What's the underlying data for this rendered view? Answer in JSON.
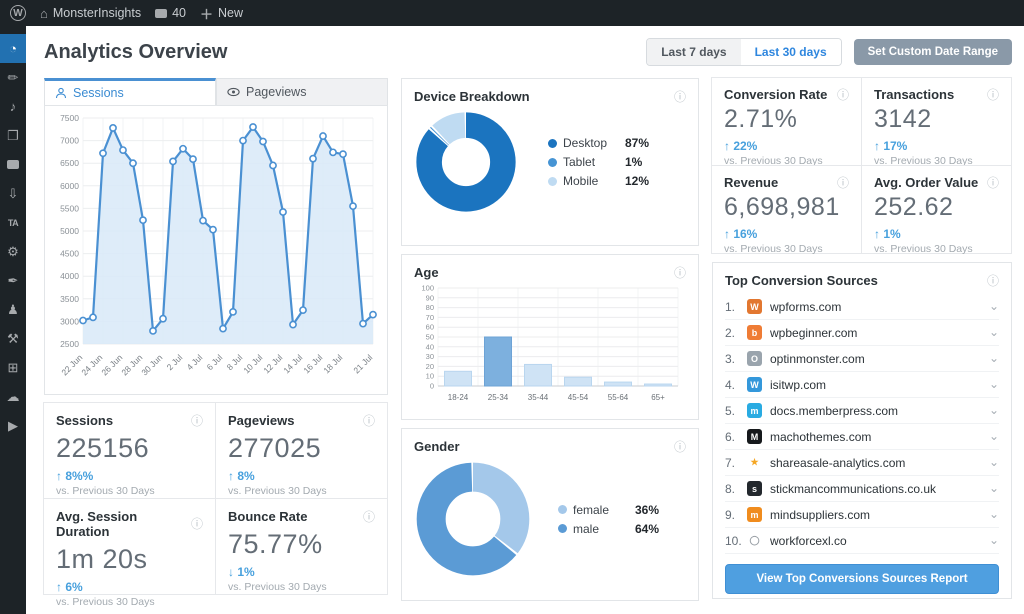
{
  "admin_bar": {
    "wp_logo": "W",
    "site_name": "MonsterInsights",
    "comments_count": "40",
    "new_label": "New"
  },
  "sidebar": {
    "items": [
      {
        "name": "monsterinsights-gauge",
        "glyph": "◔",
        "active": true
      },
      {
        "name": "posts-pin",
        "glyph": "✏",
        "active": false
      },
      {
        "name": "media",
        "glyph": "♪",
        "active": false
      },
      {
        "name": "pages",
        "glyph": "❐",
        "active": false
      },
      {
        "name": "comments",
        "glyph": "",
        "active": false
      },
      {
        "name": "screen-download",
        "glyph": "⇩",
        "active": false
      },
      {
        "name": "ta-badge",
        "glyph": "TA",
        "active": false
      },
      {
        "name": "plugin",
        "glyph": "⚙",
        "active": false
      },
      {
        "name": "brush",
        "glyph": "✒",
        "active": false
      },
      {
        "name": "users",
        "glyph": "♟",
        "active": false
      },
      {
        "name": "tools-wrench",
        "glyph": "⚒",
        "active": false
      },
      {
        "name": "settings",
        "glyph": "⊞",
        "active": false
      },
      {
        "name": "cloud",
        "glyph": "☁",
        "active": false
      },
      {
        "name": "video-play",
        "glyph": "▶",
        "active": false
      }
    ]
  },
  "header": {
    "title": "Analytics Overview",
    "range_buttons": [
      {
        "label": "Last 7 days",
        "active": false
      },
      {
        "label": "Last 30 days",
        "active": true
      }
    ],
    "custom_range_label": "Set Custom Date Range"
  },
  "tabs": [
    {
      "label": "Sessions",
      "icon": "person-icon",
      "active": true
    },
    {
      "label": "Pageviews",
      "icon": "eye-icon",
      "active": false
    }
  ],
  "chart_data": [
    {
      "id": "sessions-line",
      "type": "line",
      "title": "Sessions over time",
      "x": [
        "22 Jun",
        "23 Jun",
        "24 Jun",
        "25 Jun",
        "26 Jun",
        "27 Jun",
        "28 Jun",
        "29 Jun",
        "30 Jun",
        "1 Jul",
        "2 Jul",
        "3 Jul",
        "4 Jul",
        "5 Jul",
        "6 Jul",
        "7 Jul",
        "8 Jul",
        "9 Jul",
        "10 Jul",
        "11 Jul",
        "12 Jul",
        "13 Jul",
        "14 Jul",
        "15 Jul",
        "16 Jul",
        "17 Jul",
        "18 Jul",
        "19 Jul",
        "20 Jul",
        "21 Jul"
      ],
      "values": [
        3020,
        3090,
        6720,
        7280,
        6790,
        6500,
        5240,
        2790,
        3060,
        6540,
        6820,
        6590,
        5230,
        5030,
        2840,
        3210,
        7000,
        7300,
        6980,
        6450,
        5420,
        2930,
        3250,
        6600,
        7100,
        6740,
        6700,
        5550,
        2950,
        3150
      ],
      "tick_indices": [
        0,
        2,
        4,
        6,
        8,
        10,
        12,
        14,
        16,
        18,
        20,
        22,
        24,
        26,
        29
      ],
      "ylim": [
        2500,
        7500
      ],
      "ytick_step": 500,
      "grid": true,
      "line_color": "#4a90d2",
      "fill_color": "#d8e9f8"
    },
    {
      "id": "device-donut",
      "type": "pie",
      "title": "Device Breakdown",
      "labels": [
        "Desktop",
        "Tablet",
        "Mobile"
      ],
      "values": [
        87,
        1,
        12
      ],
      "value_labels": [
        "87%",
        "1%",
        "12%"
      ],
      "colors": [
        "#1b74bf",
        "#4694d4",
        "#bfdbf2"
      ],
      "legend_position": "right"
    },
    {
      "id": "age-bar",
      "type": "bar",
      "title": "Age",
      "categories": [
        "18-24",
        "25-34",
        "35-44",
        "45-54",
        "55-64",
        "65+"
      ],
      "values": [
        15,
        50,
        22,
        9,
        4,
        2
      ],
      "ylim": [
        0,
        100
      ],
      "ytick_step": 10,
      "grid": true,
      "bar_color": "#cfe3f5",
      "bar_border": "#b9d6ef",
      "highlight_index": 1,
      "highlight_color": "#7db0de",
      "highlight_border": "#6da3d6"
    },
    {
      "id": "gender-donut",
      "type": "pie",
      "title": "Gender",
      "labels": [
        "female",
        "male"
      ],
      "values": [
        36,
        64
      ],
      "value_labels": [
        "36%",
        "64%"
      ],
      "colors": [
        "#a4c8ea",
        "#5b9bd5"
      ],
      "legend_position": "right"
    }
  ],
  "stat_cards": {
    "left": [
      {
        "title": "Sessions",
        "value": "225156",
        "delta": "↑ 8%%",
        "sub": "vs. Previous 30 Days"
      },
      {
        "title": "Pageviews",
        "value": "277025",
        "delta": "↑ 8%",
        "sub": "vs. Previous 30 Days"
      },
      {
        "title": "Avg. Session Duration",
        "value": "1m 20s",
        "delta": "↑ 6%",
        "sub": "vs. Previous 30 Days"
      },
      {
        "title": "Bounce Rate",
        "value": "75.77%",
        "delta": "↓ 1%",
        "sub": "vs. Previous 30 Days"
      }
    ],
    "right": [
      {
        "title": "Conversion Rate",
        "value": "2.71%",
        "delta": "↑ 22%",
        "sub": "vs. Previous 30 Days"
      },
      {
        "title": "Transactions",
        "value": "3142",
        "delta": "↑ 17%",
        "sub": "vs. Previous 30 Days"
      },
      {
        "title": "Revenue",
        "value": "6,698,981",
        "delta": "↑ 16%",
        "sub": "vs. Previous 30 Days"
      },
      {
        "title": "Avg. Order Value",
        "value": "252.62",
        "delta": "↑ 1%",
        "sub": "vs. Previous 30 Days"
      }
    ]
  },
  "sources": {
    "title": "Top Conversion Sources",
    "items": [
      {
        "rank": "1.",
        "domain": "wpforms.com",
        "icon_bg": "#e27730",
        "icon_fg": "#ffffff",
        "icon_glyph": "W"
      },
      {
        "rank": "2.",
        "domain": "wpbeginner.com",
        "icon_bg": "#ef7c35",
        "icon_fg": "#ffffff",
        "icon_glyph": "b"
      },
      {
        "rank": "3.",
        "domain": "optinmonster.com",
        "icon_bg": "#9aa4ad",
        "icon_fg": "#ffffff",
        "icon_glyph": "O"
      },
      {
        "rank": "4.",
        "domain": "isitwp.com",
        "icon_bg": "#3498db",
        "icon_fg": "#ffffff",
        "icon_glyph": "W"
      },
      {
        "rank": "5.",
        "domain": "docs.memberpress.com",
        "icon_bg": "#29abe2",
        "icon_fg": "#ffffff",
        "icon_glyph": "m"
      },
      {
        "rank": "6.",
        "domain": "machothemes.com",
        "icon_bg": "#16191c",
        "icon_fg": "#ffffff",
        "icon_glyph": "M"
      },
      {
        "rank": "7.",
        "domain": "shareasale-analytics.com",
        "icon_bg": "transparent",
        "icon_fg": "#f5a623",
        "icon_glyph": "★"
      },
      {
        "rank": "8.",
        "domain": "stickmancommunications.co.uk",
        "icon_bg": "#23282d",
        "icon_fg": "#ffffff",
        "icon_glyph": "s"
      },
      {
        "rank": "9.",
        "domain": "mindsuppliers.com",
        "icon_bg": "#f08c1e",
        "icon_fg": "#ffffff",
        "icon_glyph": "m"
      },
      {
        "rank": "10.",
        "domain": "workforcexl.co",
        "icon_bg": "transparent",
        "icon_fg": "#9aa0a6",
        "icon_glyph": "◯"
      }
    ],
    "button_label": "View Top Conversions Sources Report"
  },
  "misc": {
    "info_glyph": "ⓘ",
    "chevron_glyph": "⌄",
    "accent_blue": "#2e86de"
  }
}
